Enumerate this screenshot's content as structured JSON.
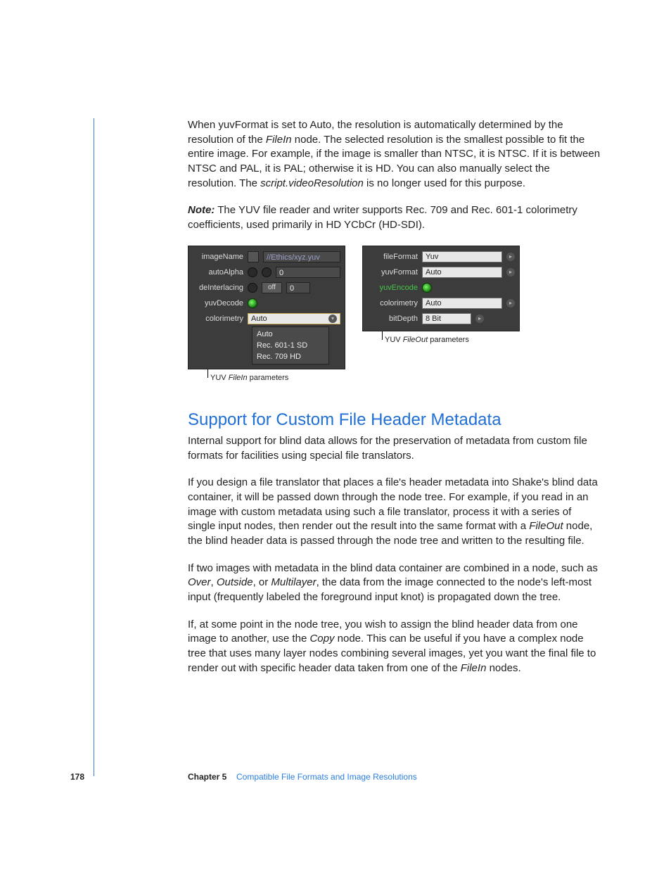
{
  "para1_a": "When yuvFormat is set to Auto, the resolution is automatically determined by the resolution of the ",
  "para1_b": "FileIn",
  "para1_c": " node. The selected resolution is the smallest possible to fit the entire image. For example, if the image is smaller than NTSC, it is NTSC. If it is between NTSC and PAL, it is PAL; otherwise it is HD. You can also manually select the resolution. The ",
  "para1_d": "script.videoResolution",
  "para1_e": " is no longer used for this purpose.",
  "note_label": "Note:",
  "note_body": "  The YUV file reader and writer supports Rec. 709 and Rec. 601-1 colorimetry coefficients, used primarily in HD YCbCr (HD-SDI).",
  "left": {
    "imageName_lbl": "imageName",
    "imageName_val": "//Ethics/xyz.yuv",
    "autoAlpha_lbl": "autoAlpha",
    "autoAlpha_val": "0",
    "deInterlacing_lbl": "deInterlacing",
    "deInterlacing_pill": "off",
    "deInterlacing_val": "0",
    "yuvDecode_lbl": "yuvDecode",
    "colorimetry_lbl": "colorimetry",
    "colorimetry_val": "Auto",
    "menu": [
      "Auto",
      "Rec. 601-1 SD",
      "Rec. 709 HD"
    ],
    "caption_a": "YUV ",
    "caption_b": "FileIn",
    "caption_c": " parameters"
  },
  "right": {
    "fileFormat_lbl": "fileFormat",
    "fileFormat_val": "Yuv",
    "yuvFormat_lbl": "yuvFormat",
    "yuvFormat_val": "Auto",
    "yuvEncode_lbl": "yuvEncode",
    "colorimetry_lbl": "colorimetry",
    "colorimetry_val": "Auto",
    "bitDepth_lbl": "bitDepth",
    "bitDepth_val": "8 Bit",
    "caption_a": "YUV ",
    "caption_b": "FileOut",
    "caption_c": " parameters"
  },
  "h2": "Support for Custom File Header Metadata",
  "para2": "Internal support for blind data allows for the preservation of metadata from custom file formats for facilities using special file translators.",
  "para3_a": "If you design a file translator that places a file's header metadata into Shake's blind data container, it will be passed down through the node tree. For example, if you read in an image with custom metadata using such a file translator, process it with a series of single input nodes, then render out the result into the same format with a ",
  "para3_b": "FileOut",
  "para3_c": " node, the blind header data is passed through the node tree and written to the resulting file.",
  "para4_a": "If two images with metadata in the blind data container are combined in a node, such as ",
  "para4_b": "Over",
  "para4_c": ", ",
  "para4_d": "Outside",
  "para4_e": ", or ",
  "para4_f": "Multilayer",
  "para4_g": ", the data from the image connected to the node's left-most input (frequently labeled the foreground input knot) is propagated down the tree.",
  "para5_a": "If, at some point in the node tree, you wish to assign the blind header data from one image to another, use the ",
  "para5_b": "Copy",
  "para5_c": " node. This can be useful if you have a complex node tree that uses many layer nodes combining several images, yet you want the final file to render out with specific header data taken from one of the ",
  "para5_d": "FileIn",
  "para5_e": " nodes.",
  "footer": {
    "page": "178",
    "chapter": "Chapter 5",
    "title": "Compatible File Formats and Image Resolutions"
  }
}
